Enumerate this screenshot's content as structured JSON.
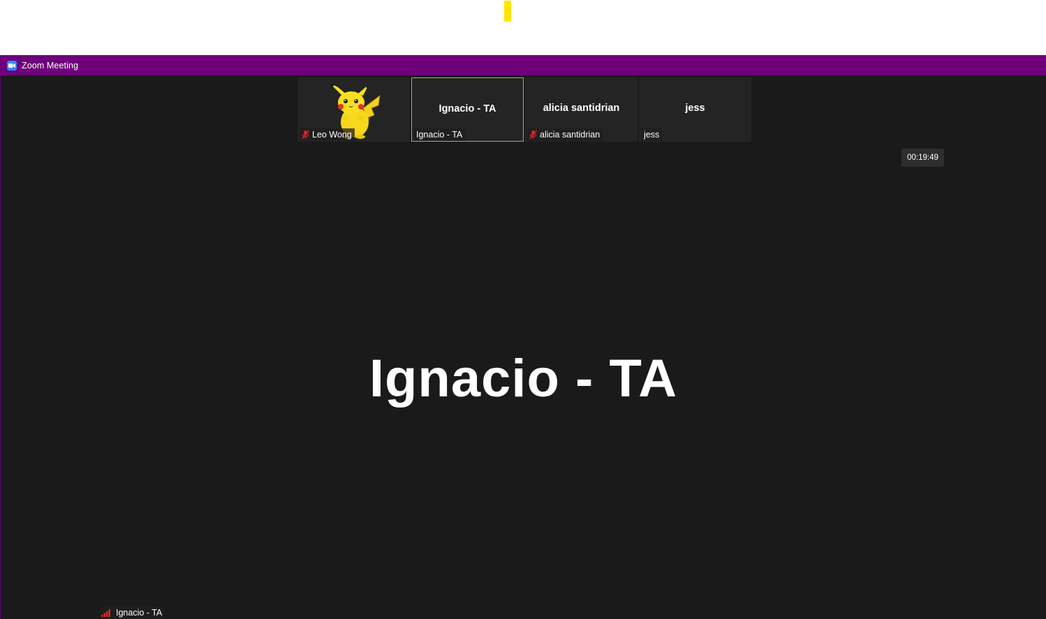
{
  "window": {
    "title": "Zoom Meeting",
    "titlebar_color": "#6e007a",
    "app_icon": "zoom-camera-icon"
  },
  "participants": [
    {
      "name": "Leo Wong",
      "muted": true,
      "avatar": "pikachu-image"
    },
    {
      "name": "Ignacio - TA",
      "label": "Ignacio - TA",
      "muted": false,
      "active_speaker": true
    },
    {
      "name": "alicia santidrian",
      "label": "alicia santidrian",
      "muted": true
    },
    {
      "name": "jess",
      "label": "jess",
      "muted": false
    }
  ],
  "timer": "00:19:49",
  "main_view": {
    "speaker_name": "Ignacio - TA",
    "speaker_label": "Ignacio - TA",
    "connection_icon": "signal-bars-icon"
  },
  "colors": {
    "active_border": "#8bc34a",
    "muted_icon": "#e02828",
    "marker": "#ffe600"
  }
}
